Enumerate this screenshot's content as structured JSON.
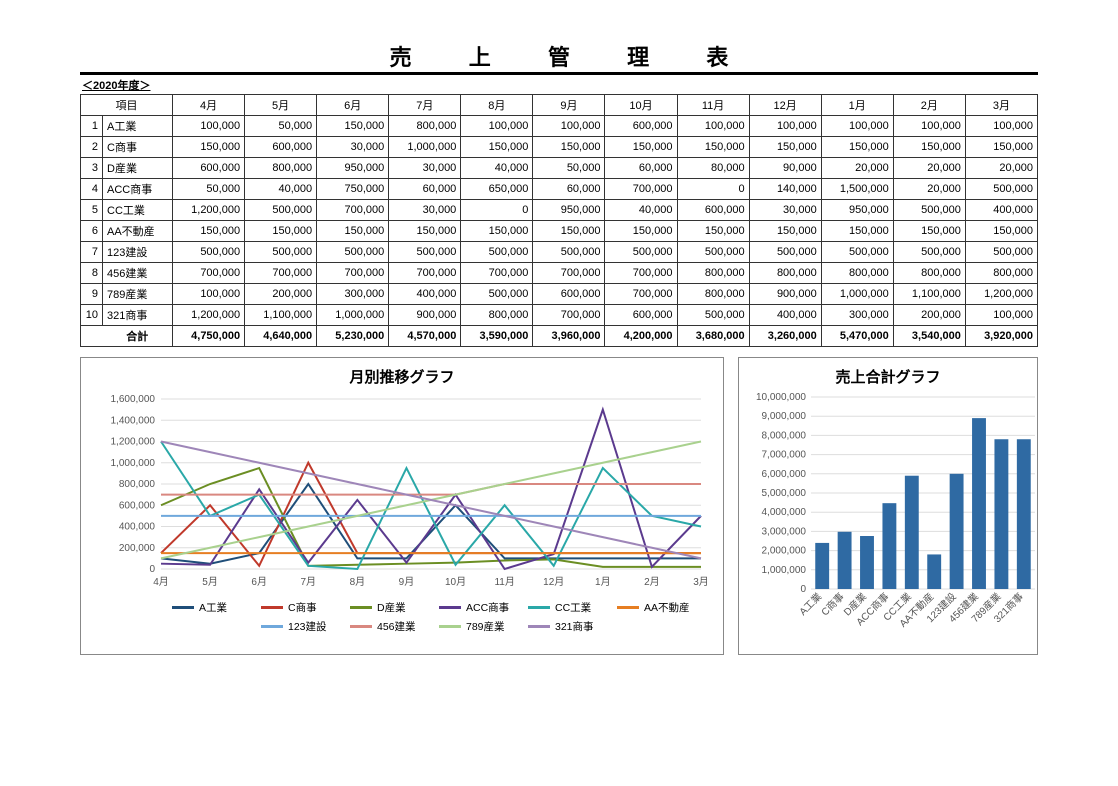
{
  "title": "売上管理表",
  "year_label": "＜2020年度＞",
  "table": {
    "header_item": "項目",
    "months": [
      "4月",
      "5月",
      "6月",
      "7月",
      "8月",
      "9月",
      "10月",
      "11月",
      "12月",
      "1月",
      "2月",
      "3月"
    ],
    "rows": [
      {
        "idx": "1",
        "name": "A工業",
        "values": [
          100000,
          50000,
          150000,
          800000,
          100000,
          100000,
          600000,
          100000,
          100000,
          100000,
          100000,
          100000
        ]
      },
      {
        "idx": "2",
        "name": "C商事",
        "values": [
          150000,
          600000,
          30000,
          1000000,
          150000,
          150000,
          150000,
          150000,
          150000,
          150000,
          150000,
          150000
        ]
      },
      {
        "idx": "3",
        "name": "D産業",
        "values": [
          600000,
          800000,
          950000,
          30000,
          40000,
          50000,
          60000,
          80000,
          90000,
          20000,
          20000,
          20000
        ]
      },
      {
        "idx": "4",
        "name": "ACC商事",
        "values": [
          50000,
          40000,
          750000,
          60000,
          650000,
          60000,
          700000,
          0,
          140000,
          1500000,
          20000,
          500000
        ]
      },
      {
        "idx": "5",
        "name": "CC工業",
        "values": [
          1200000,
          500000,
          700000,
          30000,
          0,
          950000,
          40000,
          600000,
          30000,
          950000,
          500000,
          400000
        ]
      },
      {
        "idx": "6",
        "name": "AA不動産",
        "values": [
          150000,
          150000,
          150000,
          150000,
          150000,
          150000,
          150000,
          150000,
          150000,
          150000,
          150000,
          150000
        ]
      },
      {
        "idx": "7",
        "name": "123建設",
        "values": [
          500000,
          500000,
          500000,
          500000,
          500000,
          500000,
          500000,
          500000,
          500000,
          500000,
          500000,
          500000
        ]
      },
      {
        "idx": "8",
        "name": "456建業",
        "values": [
          700000,
          700000,
          700000,
          700000,
          700000,
          700000,
          700000,
          800000,
          800000,
          800000,
          800000,
          800000
        ]
      },
      {
        "idx": "9",
        "name": "789産業",
        "values": [
          100000,
          200000,
          300000,
          400000,
          500000,
          600000,
          700000,
          800000,
          900000,
          1000000,
          1100000,
          1200000
        ]
      },
      {
        "idx": "10",
        "name": "321商事",
        "values": [
          1200000,
          1100000,
          1000000,
          900000,
          800000,
          700000,
          600000,
          500000,
          400000,
          300000,
          200000,
          100000
        ]
      }
    ],
    "total_label": "合計",
    "totals": [
      4750000,
      4640000,
      5230000,
      4570000,
      3590000,
      3960000,
      4200000,
      3680000,
      3260000,
      5470000,
      3540000,
      3920000
    ]
  },
  "chart_data": [
    {
      "type": "line",
      "title": "月別推移グラフ",
      "xlabel": "",
      "ylabel": "",
      "ylim": [
        0,
        1600000
      ],
      "y_ticks": [
        0,
        200000,
        400000,
        600000,
        800000,
        1000000,
        1200000,
        1400000,
        1600000
      ],
      "categories": [
        "4月",
        "5月",
        "6月",
        "7月",
        "8月",
        "9月",
        "10月",
        "11月",
        "12月",
        "1月",
        "2月",
        "3月"
      ],
      "series": [
        {
          "name": "A工業",
          "color": "#1f4e79",
          "values": [
            100000,
            50000,
            150000,
            800000,
            100000,
            100000,
            600000,
            100000,
            100000,
            100000,
            100000,
            100000
          ]
        },
        {
          "name": "C商事",
          "color": "#c0392b",
          "values": [
            150000,
            600000,
            30000,
            1000000,
            150000,
            150000,
            150000,
            150000,
            150000,
            150000,
            150000,
            150000
          ]
        },
        {
          "name": "D産業",
          "color": "#6b8e23",
          "values": [
            600000,
            800000,
            950000,
            30000,
            40000,
            50000,
            60000,
            80000,
            90000,
            20000,
            20000,
            20000
          ]
        },
        {
          "name": "ACC商事",
          "color": "#5b3a8e",
          "values": [
            50000,
            40000,
            750000,
            60000,
            650000,
            60000,
            700000,
            0,
            140000,
            1500000,
            20000,
            500000
          ]
        },
        {
          "name": "CC工業",
          "color": "#2aa8a8",
          "values": [
            1200000,
            500000,
            700000,
            30000,
            0,
            950000,
            40000,
            600000,
            30000,
            950000,
            500000,
            400000
          ]
        },
        {
          "name": "AA不動産",
          "color": "#e67e22",
          "values": [
            150000,
            150000,
            150000,
            150000,
            150000,
            150000,
            150000,
            150000,
            150000,
            150000,
            150000,
            150000
          ]
        },
        {
          "name": "123建設",
          "color": "#6fa8dc",
          "values": [
            500000,
            500000,
            500000,
            500000,
            500000,
            500000,
            500000,
            500000,
            500000,
            500000,
            500000,
            500000
          ]
        },
        {
          "name": "456建業",
          "color": "#d98880",
          "values": [
            700000,
            700000,
            700000,
            700000,
            700000,
            700000,
            700000,
            800000,
            800000,
            800000,
            800000,
            800000
          ]
        },
        {
          "name": "789産業",
          "color": "#a9d18e",
          "values": [
            100000,
            200000,
            300000,
            400000,
            500000,
            600000,
            700000,
            800000,
            900000,
            1000000,
            1100000,
            1200000
          ]
        },
        {
          "name": "321商事",
          "color": "#9e86b8",
          "values": [
            1200000,
            1100000,
            1000000,
            900000,
            800000,
            700000,
            600000,
            500000,
            400000,
            300000,
            200000,
            100000
          ]
        }
      ]
    },
    {
      "type": "bar",
      "title": "売上合計グラフ",
      "xlabel": "",
      "ylabel": "",
      "ylim": [
        0,
        10000000
      ],
      "y_ticks": [
        0,
        1000000,
        2000000,
        3000000,
        4000000,
        5000000,
        6000000,
        7000000,
        8000000,
        9000000,
        10000000
      ],
      "categories": [
        "A工業",
        "C商事",
        "D産業",
        "ACC商事",
        "CC工業",
        "AA不動産",
        "123建設",
        "456建業",
        "789産業",
        "321商事"
      ],
      "values": [
        2400000,
        2980000,
        2760000,
        4470000,
        5900000,
        1800000,
        6000000,
        8900000,
        7800000,
        7800000
      ],
      "color": "#2f6aa3"
    }
  ]
}
